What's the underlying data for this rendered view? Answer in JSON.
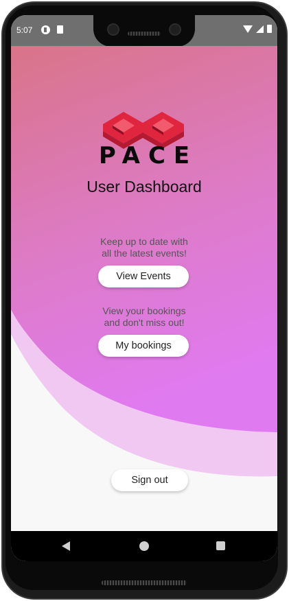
{
  "status_bar": {
    "time": "5:07"
  },
  "brand": {
    "name": "PACE",
    "logo_icon": "infinity-logo-icon",
    "logo_color": "#e0263f"
  },
  "page": {
    "title": "User Dashboard"
  },
  "events_section": {
    "caption_line1": "Keep up to date with",
    "caption_line2": "all the latest events!",
    "button_label": "View Events"
  },
  "bookings_section": {
    "caption_line1": "View your bookings",
    "caption_line2": "and don't miss out!",
    "button_label": "My bookings"
  },
  "sign_out": {
    "button_label": "Sign out"
  },
  "navigation": {
    "back_icon": "back-triangle-icon",
    "home_icon": "home-circle-icon",
    "recents_icon": "recents-square-icon"
  },
  "theme": {
    "gradient_top": "#d97488",
    "gradient_bottom": "#e07af0",
    "wave_light": "#f0c8f2",
    "background": "#f8f8f8"
  }
}
